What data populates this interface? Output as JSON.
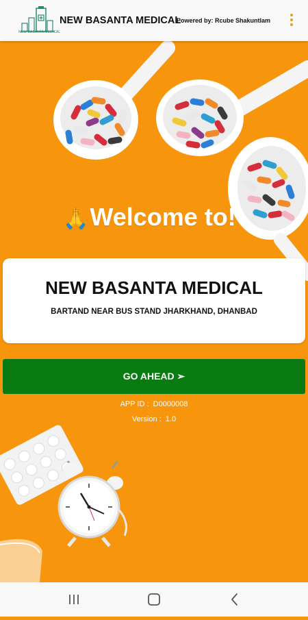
{
  "appbar": {
    "title": "NEW BASANTA MEDICAL",
    "logo_text": "NEW BASANTA MEDICAL",
    "powered_by": "Powered by: Rcube Shakuntlam",
    "menu_icon": "more-vert-icon"
  },
  "welcome": {
    "emoji": "🙏",
    "text": "Welcome to!"
  },
  "store": {
    "name": "NEW BASANTA MEDICAL",
    "address": "BARTAND NEAR BUS STAND JHARKHAND, DHANBAD"
  },
  "actions": {
    "go_ahead_label": "GO AHEAD ➢"
  },
  "app_info": {
    "app_id": "APP ID :  D0000008",
    "version": "Version :  1.0"
  },
  "navbar": {
    "recent_icon": "recent-apps-icon",
    "home_icon": "home-icon",
    "back_icon": "back-icon"
  },
  "colors": {
    "background": "#f7950c",
    "button": "#0a7a12",
    "card": "#ffffff",
    "appbar": "#f8f8f8"
  }
}
